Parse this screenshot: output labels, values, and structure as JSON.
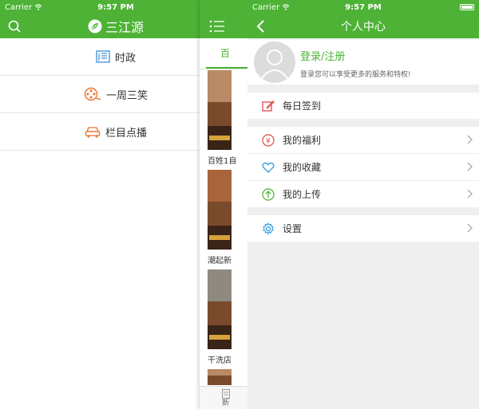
{
  "status": {
    "carrier": "Carrier",
    "time": "9:57 PM"
  },
  "left": {
    "app_title": "三江源",
    "items": [
      {
        "label": "时政",
        "icon": "newspaper-icon"
      },
      {
        "label": "一周三笑",
        "icon": "film-reel-icon"
      },
      {
        "label": "栏目点播",
        "icon": "car-icon"
      }
    ]
  },
  "middle": {
    "tab_label": "百",
    "items": [
      {
        "caption": "百姓1自"
      },
      {
        "caption": "潮起新"
      },
      {
        "caption": "干洗店"
      }
    ],
    "bottom_label": "新"
  },
  "right": {
    "title": "个人中心",
    "login_label": "登录/注册",
    "login_subtitle": "登录您可以享受更多的服务和特权!",
    "checkin_label": "每日签到",
    "group2": [
      {
        "label": "我的福利",
        "icon": "yen-circle-icon"
      },
      {
        "label": "我的收藏",
        "icon": "heart-icon"
      },
      {
        "label": "我的上传",
        "icon": "upload-circle-icon"
      }
    ],
    "settings_label": "设置"
  },
  "colors": {
    "accent": "#4db236"
  }
}
